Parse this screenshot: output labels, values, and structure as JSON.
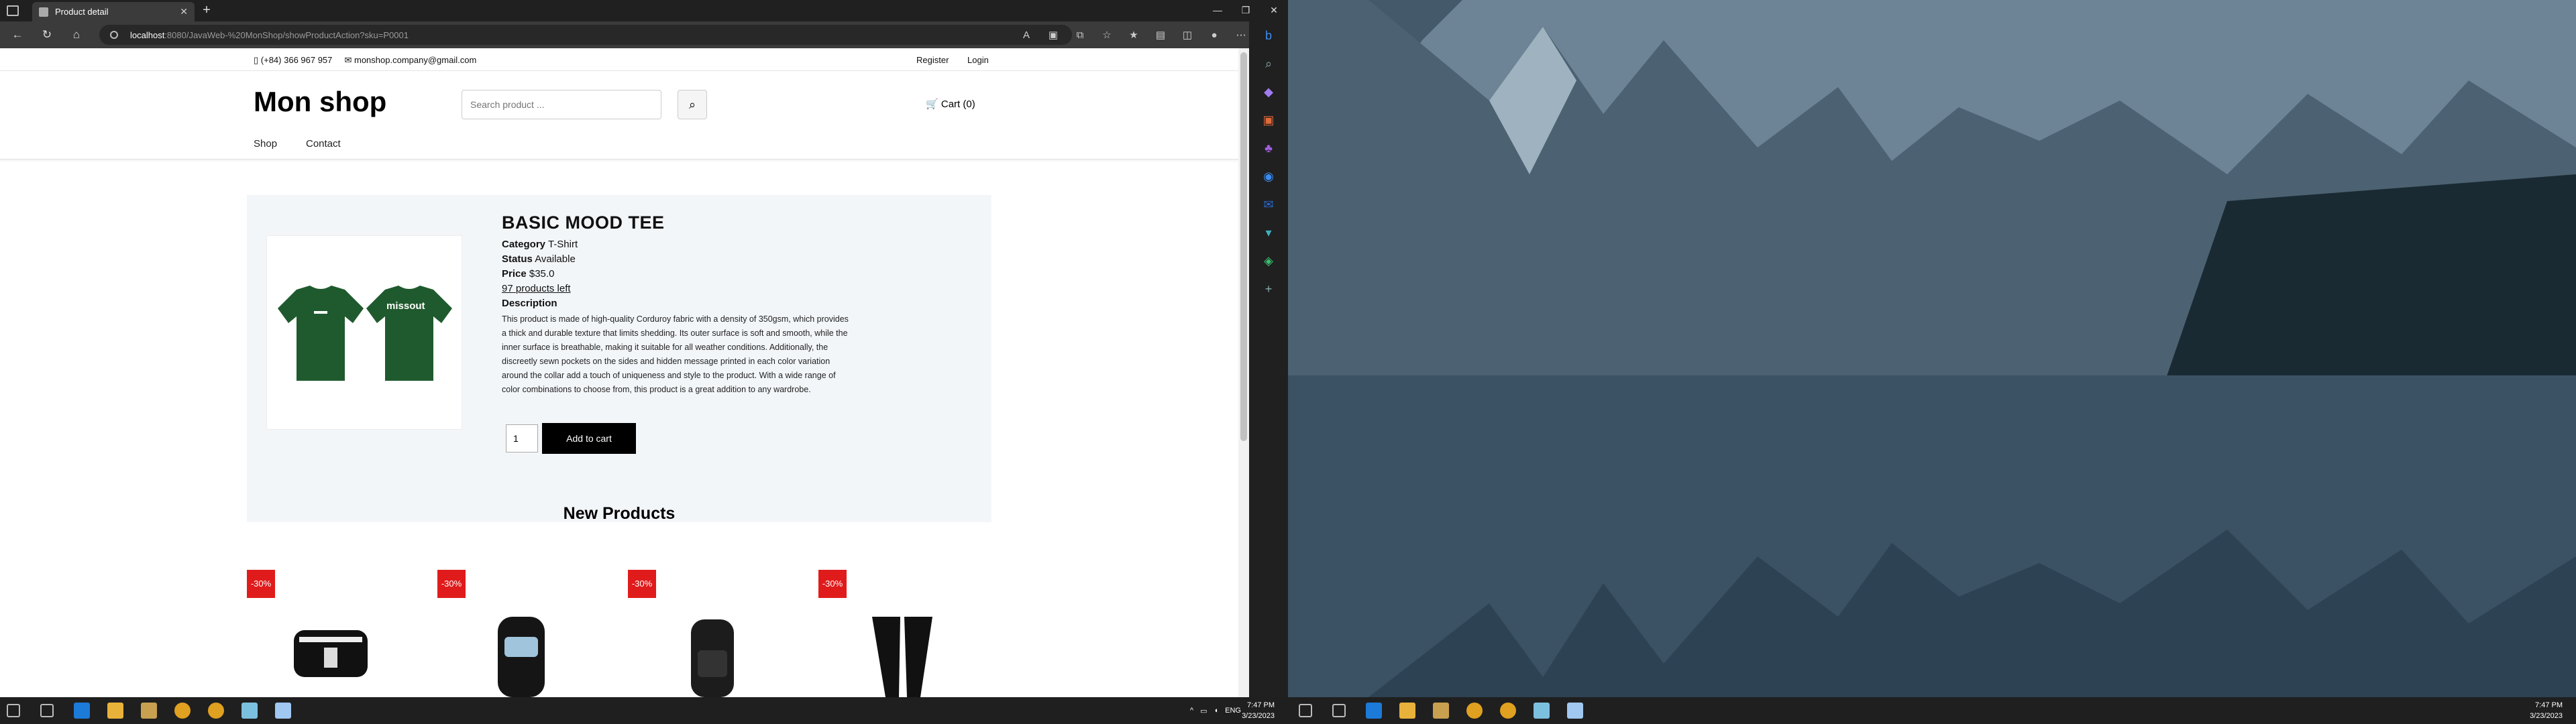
{
  "browser": {
    "tab_title": "Product detail",
    "url_host": "localhost",
    "url_path": ":8080/JavaWeb-%20MonShop/showProductAction?sku=P0001"
  },
  "site": {
    "phone": "(+84) 366 967 957",
    "email": "monshop.company@gmail.com",
    "register": "Register",
    "login": "Login",
    "logo": "Mon shop",
    "search_placeholder": "Search product ...",
    "cart": "Cart (0)",
    "menu": [
      "Shop",
      "Contact"
    ]
  },
  "product": {
    "name": "BASIC MOOD TEE",
    "category_label": "Category",
    "category": "T-Shirt",
    "status_label": "Status",
    "status": "Available",
    "price_label": "Price",
    "price": "$35.0",
    "stock_count": "97",
    "stock_text": "products left",
    "description_label": "Description",
    "description": "This product is made of high-quality Corduroy fabric with a density of 350gsm, which provides a thick and durable texture that limits shedding. Its outer surface is soft and smooth, while the inner surface is breathable, making it suitable for all weather conditions. Additionally, the discreetly sewn pockets on the sides and hidden message printed in each color variation around the collar add a touch of uniqueness and style to the product. With a wide range of color combinations to choose from, this product is a great addition to any wardrobe.",
    "tee_print": "missout",
    "quantity": "1",
    "add_to_cart": "Add to cart"
  },
  "new_products": {
    "title": "New Products",
    "items": [
      {
        "badge": "-30%",
        "kind": "bag"
      },
      {
        "badge": "-30%",
        "kind": "backpack-light"
      },
      {
        "badge": "-30%",
        "kind": "backpack-dark"
      },
      {
        "badge": "-30%",
        "kind": "pants"
      }
    ]
  },
  "system": {
    "time": "7:47 PM",
    "date": "3/23/2023",
    "lang": "ENG"
  },
  "colors": {
    "accent_badge": "#e01b1b",
    "tee_green": "#1f5a2e",
    "detail_bg": "#f3f6f9"
  }
}
